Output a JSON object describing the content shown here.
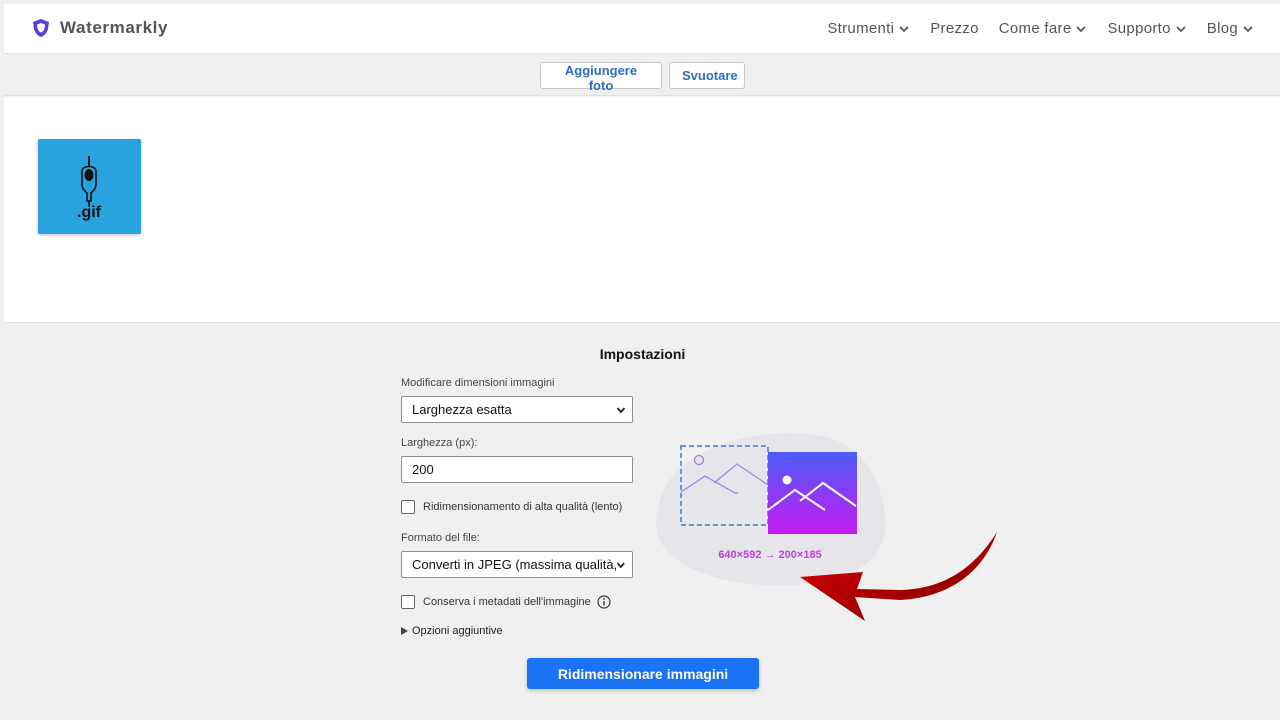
{
  "header": {
    "logo_text": "Watermarkly",
    "nav": [
      {
        "label": "Strumenti",
        "dropdown": true
      },
      {
        "label": "Prezzo",
        "dropdown": false
      },
      {
        "label": "Come fare",
        "dropdown": true
      },
      {
        "label": "Supporto",
        "dropdown": true
      },
      {
        "label": "Blog",
        "dropdown": true
      }
    ]
  },
  "toolbar": {
    "add_label": "Aggiungere foto",
    "clear_label": "Svuotare"
  },
  "gallery": {
    "thumbnail_label": ".gif"
  },
  "settings": {
    "title": "Impostazioni",
    "resize_mode": {
      "label": "Modificare dimensioni immagini",
      "value": "Larghezza esatta"
    },
    "width": {
      "label": "Larghezza (px):",
      "value": "200"
    },
    "hq_resize": {
      "label": "Ridimensionamento di alta qualità (lento)",
      "checked": false
    },
    "format": {
      "label": "Formato del file:",
      "value": "Converti in JPEG (massima qualità, f"
    },
    "keep_metadata": {
      "label": "Conserva i metadati dell'immagine",
      "checked": false
    },
    "more_options_label": "Opzioni aggiuntive",
    "submit_label": "Ridimensionare immagini"
  },
  "illustration": {
    "dimensions_text": "640×592 → 200×185"
  },
  "colors": {
    "accent_blue": "#1a73f2",
    "link_blue": "#2f6ec1",
    "gradient_start": "#4d5cf7",
    "gradient_end": "#c51cf0",
    "annotation_arrow": "#c40000"
  }
}
